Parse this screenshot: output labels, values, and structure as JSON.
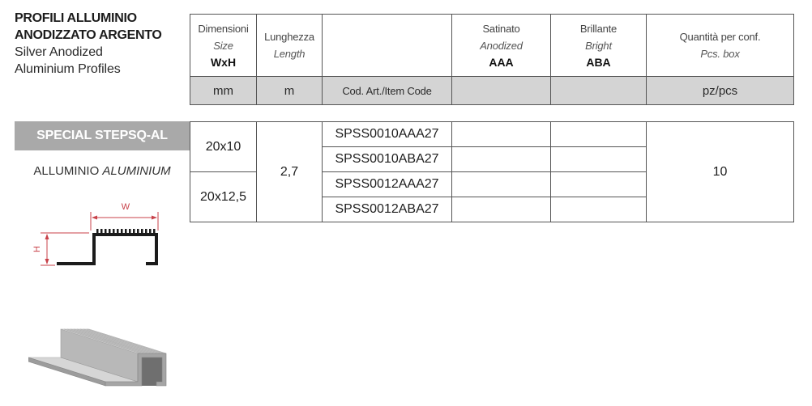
{
  "title": {
    "it_line1": "PROFILI ALLUMINIO",
    "it_line2": "ANODIZZATO ARGENTO",
    "en_line1": "Silver Anodized",
    "en_line2": "Aluminium Profiles"
  },
  "header": {
    "size": {
      "it": "Dimensioni",
      "en": "Size",
      "label": "WxH",
      "unit": "mm"
    },
    "length": {
      "it": "Lunghezza",
      "en": "Length",
      "unit": "m"
    },
    "code": {
      "unit": "Cod. Art./Item Code"
    },
    "anodized": {
      "it": "Satinato",
      "en": "Anodized",
      "label": "AAA"
    },
    "bright": {
      "it": "Brillante",
      "en": "Bright",
      "label": "ABA"
    },
    "quantity": {
      "it": "Quantità per conf.",
      "en": "Pcs. box",
      "unit": "pz/pcs"
    }
  },
  "product": {
    "name": "SPECIAL STEPSQ-AL",
    "material_it": "ALLUMINIO",
    "material_en": "ALUMINIUM",
    "dimension_labels": {
      "width": "W",
      "height": "H"
    }
  },
  "rows": {
    "sizes": [
      "20x10",
      "20x12,5"
    ],
    "length": "2,7",
    "item_codes": [
      "SPSS0010AAA27",
      "SPSS0010ABA27",
      "SPSS0012AAA27",
      "SPSS0012ABA27"
    ],
    "quantity": "10"
  },
  "colors": {
    "header_band": "#d4d4d4",
    "product_band": "#a9a9a9",
    "dimension_red": "#c8424a",
    "border": "#555555"
  }
}
